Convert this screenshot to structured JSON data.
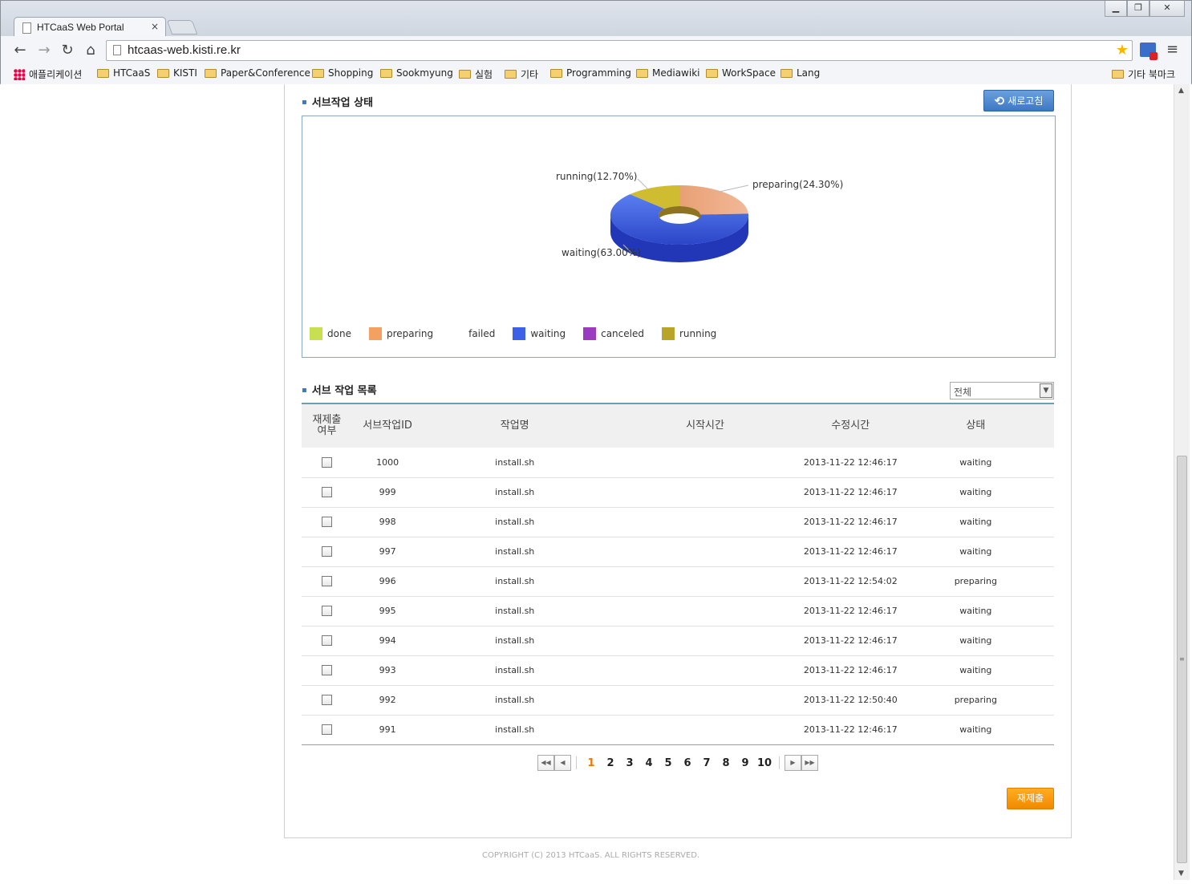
{
  "browser": {
    "tab_title": "HTCaaS Web Portal",
    "tab_close": "×",
    "url": "htcaas-web.kisti.re.kr",
    "bookmarks": [
      {
        "label": "애플리케이션",
        "type": "apps"
      },
      {
        "label": "HTCaaS",
        "type": "folder"
      },
      {
        "label": "KISTI",
        "type": "folder"
      },
      {
        "label": "Paper&Conference",
        "type": "folder"
      },
      {
        "label": "Shopping",
        "type": "folder"
      },
      {
        "label": "Sookmyung",
        "type": "folder"
      },
      {
        "label": "실험",
        "type": "folder"
      },
      {
        "label": "기타",
        "type": "folder"
      },
      {
        "label": "Programming",
        "type": "folder"
      },
      {
        "label": "Mediawiki",
        "type": "folder"
      },
      {
        "label": "WorkSpace",
        "type": "folder"
      },
      {
        "label": "Lang",
        "type": "folder"
      }
    ],
    "other_bookmarks": "기타 북마크"
  },
  "status_section": {
    "title": "서브작업 상태",
    "refresh_label": "새로고침"
  },
  "chart_data": {
    "type": "pie",
    "slices": [
      {
        "label": "preparing",
        "value": 24.3,
        "color": "#f0a070"
      },
      {
        "label": "waiting",
        "value": 63.0,
        "color": "#3c5ee0"
      },
      {
        "label": "running",
        "value": 12.7,
        "color": "#c8b428"
      }
    ],
    "slice_labels": [
      "preparing(24.30%)",
      "waiting(63.00%)",
      "running(12.70%)"
    ],
    "legend": [
      {
        "label": "done",
        "color": "#c8e050"
      },
      {
        "label": "preparing",
        "color": "#f4a060"
      },
      {
        "label": "failed",
        "color": ""
      },
      {
        "label": "waiting",
        "color": "#3c60e8"
      },
      {
        "label": "canceled",
        "color": "#9b3cc0"
      },
      {
        "label": "running",
        "color": "#b8a428"
      }
    ]
  },
  "list_section": {
    "title": "서브 작업 목록",
    "filter_value": "전체",
    "columns": [
      "재제출\n여부",
      "서브작업ID",
      "작업명",
      "시작시간",
      "수정시간",
      "상태"
    ],
    "rows": [
      {
        "id": "1000",
        "name": "install.sh",
        "start": "",
        "modified": "2013-11-22 12:46:17",
        "status": "waiting"
      },
      {
        "id": "999",
        "name": "install.sh",
        "start": "",
        "modified": "2013-11-22 12:46:17",
        "status": "waiting"
      },
      {
        "id": "998",
        "name": "install.sh",
        "start": "",
        "modified": "2013-11-22 12:46:17",
        "status": "waiting"
      },
      {
        "id": "997",
        "name": "install.sh",
        "start": "",
        "modified": "2013-11-22 12:46:17",
        "status": "waiting"
      },
      {
        "id": "996",
        "name": "install.sh",
        "start": "",
        "modified": "2013-11-22 12:54:02",
        "status": "preparing"
      },
      {
        "id": "995",
        "name": "install.sh",
        "start": "",
        "modified": "2013-11-22 12:46:17",
        "status": "waiting"
      },
      {
        "id": "994",
        "name": "install.sh",
        "start": "",
        "modified": "2013-11-22 12:46:17",
        "status": "waiting"
      },
      {
        "id": "993",
        "name": "install.sh",
        "start": "",
        "modified": "2013-11-22 12:46:17",
        "status": "waiting"
      },
      {
        "id": "992",
        "name": "install.sh",
        "start": "",
        "modified": "2013-11-22 12:50:40",
        "status": "preparing"
      },
      {
        "id": "991",
        "name": "install.sh",
        "start": "",
        "modified": "2013-11-22 12:46:17",
        "status": "waiting"
      }
    ],
    "pages": [
      "1",
      "2",
      "3",
      "4",
      "5",
      "6",
      "7",
      "8",
      "9",
      "10"
    ],
    "current_page": "1",
    "resubmit_label": "재제출"
  },
  "footer": {
    "copyright": "COPYRIGHT (C) 2013 HTCaaS. ALL RIGHTS RESERVED."
  }
}
